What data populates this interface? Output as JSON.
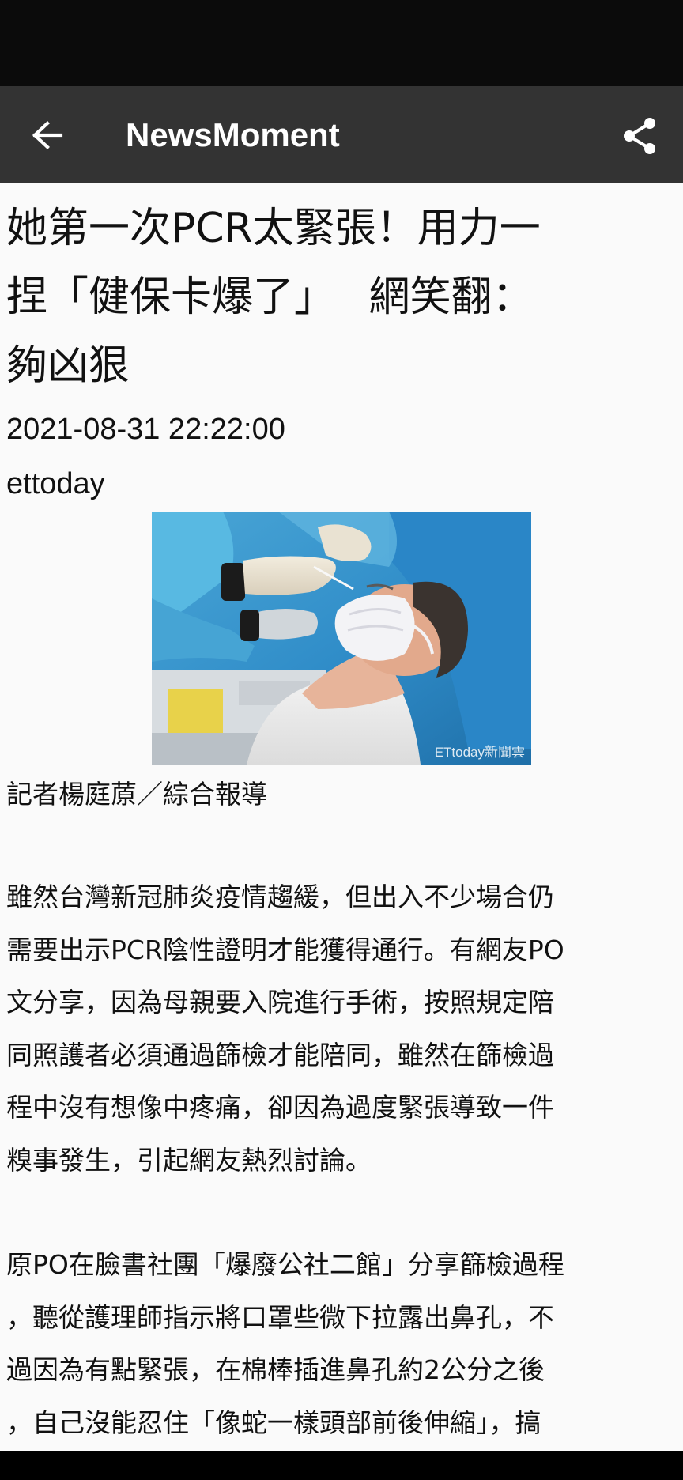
{
  "app_bar": {
    "title": "NewsMoment",
    "back_icon": "arrow-left-icon",
    "share_icon": "share-icon",
    "background": "#333333"
  },
  "article": {
    "headline_lines": [
      "她第一次PCR太緊張！用力一",
      "捏「健保卡爆了」　 網笑翻：",
      "夠凶狠"
    ],
    "datetime": "2021-08-31 22:22:00",
    "source": "ettoday",
    "image_watermark": "ETtoday新聞雲",
    "byline": "記者楊庭蒝／綜合報導",
    "paragraphs": [
      [
        "雖然台灣新冠肺炎疫情趨緩，但出入不少場合仍",
        "需要出示PCR陰性證明才能獲得通行。有網友PO",
        "文分享，因為母親要入院進行手術，按照規定陪",
        "同照護者必須通過篩檢才能陪同，雖然在篩檢過",
        "程中沒有想像中疼痛，卻因為過度緊張導致一件",
        "糗事發生，引起網友熱烈討論。"
      ],
      [
        "原PO在臉書社團「爆廢公社二館」分享篩檢過程",
        "，聽從護理師指示將口罩些微下拉露出鼻孔，不",
        "過因為有點緊張，在棉棒插進鼻孔約2公分之後",
        "，自己沒能忍住「像蛇一樣頭部前後伸縮」，搞"
      ]
    ]
  }
}
